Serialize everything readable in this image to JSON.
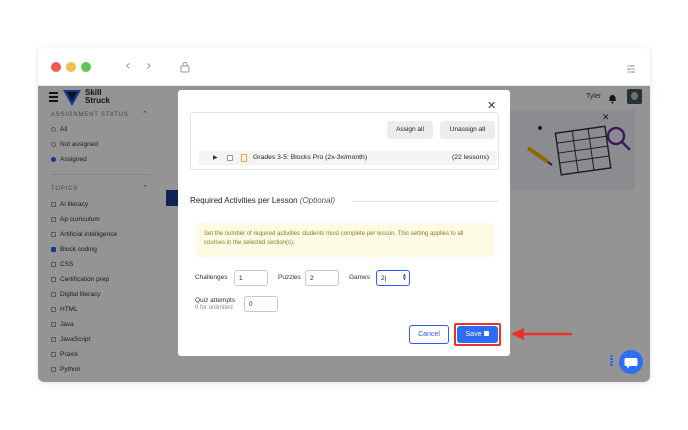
{
  "app": {
    "logo_text_1": "Skill",
    "logo_text_2": "Struck",
    "user_name": "Tyler"
  },
  "sidebar": {
    "assignment_status": {
      "title": "ASSIGNMENT STATUS",
      "options": [
        {
          "label": "All",
          "selected": false
        },
        {
          "label": "Not assigned",
          "selected": false
        },
        {
          "label": "Assigned",
          "selected": true
        }
      ]
    },
    "topics": {
      "title": "TOPICS",
      "items": [
        {
          "label": "Ai literacy",
          "checked": false
        },
        {
          "label": "Ap curriculum",
          "checked": false
        },
        {
          "label": "Artificial intelligence",
          "checked": false
        },
        {
          "label": "Block coding",
          "checked": true
        },
        {
          "label": "CSS",
          "checked": false
        },
        {
          "label": "Certification prep",
          "checked": false
        },
        {
          "label": "Digital literacy",
          "checked": false
        },
        {
          "label": "HTML",
          "checked": false
        },
        {
          "label": "Java",
          "checked": false
        },
        {
          "label": "JavaScript",
          "checked": false
        },
        {
          "label": "Praxis",
          "checked": false
        },
        {
          "label": "Python",
          "checked": false
        }
      ]
    }
  },
  "background": {
    "frag_1": "2",
    "frag_2": "G",
    "frag_3": "U"
  },
  "modal": {
    "assign_all": "Assign all",
    "unassign_all": "Unassign all",
    "lesson": {
      "name": "Grades 3-5: Blocks Pro (2x-3x/month)",
      "count": "(22 lessons)"
    },
    "section_title": "Required Activities per Lesson",
    "section_optional": "(Optional)",
    "info_text": "Set the number of required activities students must complete per lesson. This setting applies to all courses in the selected section(s).",
    "fields": {
      "challenges_label": "Challenges",
      "challenges_value": "1",
      "puzzles_label": "Puzzles",
      "puzzles_value": "2",
      "games_label": "Games",
      "games_value": "2",
      "quiz_label": "Quiz attempts",
      "quiz_sub": "0 for unlimited",
      "quiz_value": "0"
    },
    "cancel": "Cancel",
    "save": "Save"
  },
  "colors": {
    "primary": "#2d5cf6",
    "highlight": "#e8322b",
    "info_bg": "#fdfbe3"
  }
}
